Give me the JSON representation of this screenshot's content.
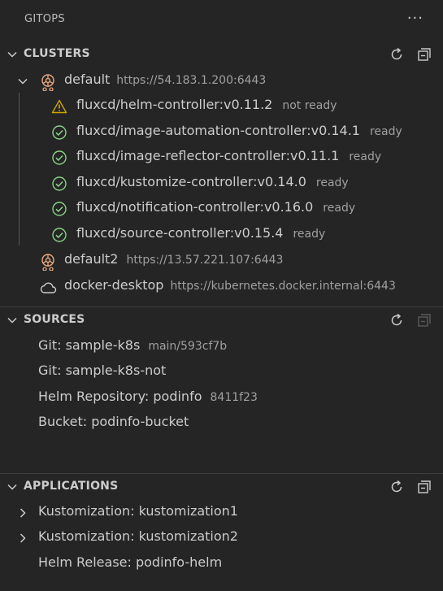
{
  "panel": {
    "title": "GITOPS",
    "more_label": "···"
  },
  "clusters": {
    "header": "CLUSTERS",
    "refresh_icon": "refresh-icon",
    "collapse_icon": "collapse-all-icon",
    "items": [
      {
        "name": "default",
        "url": "https://54.183.1.200:6443",
        "icon": "kubernetes-cluster-icon",
        "expanded": true,
        "children": [
          {
            "name": "fluxcd/helm-controller:v0.11.2",
            "status": "not ready",
            "icon": "warning-icon"
          },
          {
            "name": "fluxcd/image-automation-controller:v0.14.1",
            "status": "ready",
            "icon": "check-circle-icon"
          },
          {
            "name": "fluxcd/image-reflector-controller:v0.11.1",
            "status": "ready",
            "icon": "check-circle-icon"
          },
          {
            "name": "fluxcd/kustomize-controller:v0.14.0",
            "status": "ready",
            "icon": "check-circle-icon"
          },
          {
            "name": "fluxcd/notification-controller:v0.16.0",
            "status": "ready",
            "icon": "check-circle-icon"
          },
          {
            "name": "fluxcd/source-controller:v0.15.4",
            "status": "ready",
            "icon": "check-circle-icon"
          }
        ]
      },
      {
        "name": "default2",
        "url": "https://13.57.221.107:6443",
        "icon": "kubernetes-cluster-icon"
      },
      {
        "name": "docker-desktop",
        "url": "https://kubernetes.docker.internal:6443",
        "icon": "cloud-icon"
      }
    ]
  },
  "sources": {
    "header": "SOURCES",
    "items": [
      {
        "label": "Git: sample-k8s",
        "desc": "main/593cf7b"
      },
      {
        "label": "Git: sample-k8s-not",
        "desc": ""
      },
      {
        "label": "Helm Repository: podinfo",
        "desc": "8411f23"
      },
      {
        "label": "Bucket: podinfo-bucket",
        "desc": ""
      }
    ]
  },
  "applications": {
    "header": "APPLICATIONS",
    "items": [
      {
        "label": "Kustomization: kustomization1",
        "expandable": true
      },
      {
        "label": "Kustomization: kustomization2",
        "expandable": true
      },
      {
        "label": "Helm Release: podinfo-helm",
        "expandable": false
      }
    ]
  },
  "colors": {
    "background": "#252526",
    "text": "#cccccc",
    "description": "#a0a0a0",
    "ok_green": "#89d185",
    "warning_yellow": "#cca700",
    "cluster_icon": "#e8a87c"
  }
}
